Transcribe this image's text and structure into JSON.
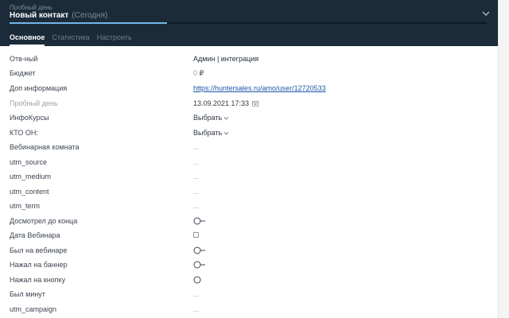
{
  "header": {
    "stage": "Пробный день",
    "title": "Новый контакт",
    "date_hint": "(Сегодня)",
    "progress": 0.33
  },
  "tabs": [
    {
      "label": "Основное",
      "active": true
    },
    {
      "label": "Статистика",
      "active": false
    },
    {
      "label": "Настроить",
      "active": false
    }
  ],
  "fields": {
    "responsible": {
      "label": "Отв-ный",
      "value": "Админ | интеграция"
    },
    "budget": {
      "label": "Бюджет",
      "value": "0",
      "currency": "₽"
    },
    "extra_info": {
      "label": "Доп информация",
      "value": "https://huntersales.ru/amo/user/12720533"
    },
    "trial_day": {
      "label": "Пробный день",
      "value": "13.09.2021 17:33"
    },
    "info_courses": {
      "label": "ИнфоКурсы",
      "value": "Выбрать"
    },
    "who_is": {
      "label": "КТО ОН:",
      "value": "Выбрать"
    },
    "webinar_room": {
      "label": "Вебинарная комната",
      "value": "..."
    },
    "utm_source": {
      "label": "utm_source",
      "value": "..."
    },
    "utm_medium": {
      "label": "utm_medium",
      "value": "..."
    },
    "utm_content": {
      "label": "utm_content",
      "value": "..."
    },
    "utm_term": {
      "label": "utm_term",
      "value": "..."
    },
    "watched_to_end": {
      "label": "Досмотрел до конца"
    },
    "webinar_date": {
      "label": "Дата Вебинара"
    },
    "was_on_webinar": {
      "label": "Был на вебинаре"
    },
    "clicked_banner": {
      "label": "Нажал на баннер"
    },
    "clicked_button": {
      "label": "Нажал на кнопку"
    },
    "minutes_spent": {
      "label": "Был минут",
      "value": "..."
    },
    "utm_campaign": {
      "label": "utm_campaign",
      "value": "..."
    }
  },
  "colors": {
    "header_bg": "#1b2b3a",
    "progress": "#74b6e8",
    "link": "#1e55a9"
  },
  "icons": {
    "chevron": "chevron-down-icon",
    "calendar": "calendar-icon",
    "toggle": "toggle-switch-icon",
    "radio": "radio-circle-icon"
  }
}
